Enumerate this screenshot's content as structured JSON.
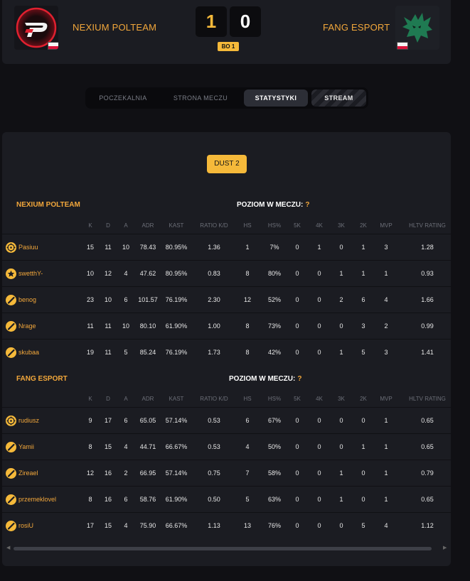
{
  "header": {
    "home": {
      "name": "NEXIUM POLTEAM",
      "score": "1"
    },
    "away": {
      "name": "FANG ESPORT",
      "score": "0"
    },
    "format": "BO 1"
  },
  "tabs": [
    {
      "label": "POCZEKALNIA",
      "active": false
    },
    {
      "label": "STRONA MECZU",
      "active": false
    },
    {
      "label": "STATYSTYKI",
      "active": true
    },
    {
      "label": "STREAM",
      "active": false
    }
  ],
  "map": "DUST 2",
  "columns": [
    "K",
    "D",
    "A",
    "ADR",
    "KAST",
    "RATIO K/D",
    "HS",
    "HS%",
    "5K",
    "4K",
    "3K",
    "2K",
    "MVP",
    "HLTV RATING"
  ],
  "teams": [
    {
      "name": "NEXIUM POLTEAM",
      "level_label": "POZIOM W MECZU:",
      "level_value": "?",
      "players": [
        {
          "icon": "crosshair-icon",
          "name": "Pasiuu",
          "stats": [
            "15",
            "11",
            "10",
            "78.43",
            "80.95%",
            "1.36",
            "1",
            "7%",
            "0",
            "1",
            "0",
            "1",
            "3",
            "1.28"
          ]
        },
        {
          "icon": "star-icon",
          "name": "swetthY-",
          "stats": [
            "10",
            "12",
            "4",
            "47.62",
            "80.95%",
            "0.83",
            "8",
            "80%",
            "0",
            "0",
            "1",
            "1",
            "1",
            "0.93"
          ]
        },
        {
          "icon": "slash-icon",
          "name": "benog",
          "stats": [
            "23",
            "10",
            "6",
            "101.57",
            "76.19%",
            "2.30",
            "12",
            "52%",
            "0",
            "0",
            "2",
            "6",
            "4",
            "1.66"
          ]
        },
        {
          "icon": "slash-icon",
          "name": "Nrage",
          "stats": [
            "11",
            "11",
            "10",
            "80.10",
            "61.90%",
            "1.00",
            "8",
            "73%",
            "0",
            "0",
            "0",
            "3",
            "2",
            "0.99"
          ]
        },
        {
          "icon": "slash-icon",
          "name": "skubaa",
          "stats": [
            "19",
            "11",
            "5",
            "85.24",
            "76.19%",
            "1.73",
            "8",
            "42%",
            "0",
            "0",
            "1",
            "5",
            "3",
            "1.41"
          ]
        }
      ]
    },
    {
      "name": "FANG ESPORT",
      "level_label": "POZIOM W MECZU:",
      "level_value": "?",
      "players": [
        {
          "icon": "crosshair-icon",
          "name": "rudiusz",
          "stats": [
            "9",
            "17",
            "6",
            "65.05",
            "57.14%",
            "0.53",
            "6",
            "67%",
            "0",
            "0",
            "0",
            "0",
            "1",
            "0.65"
          ]
        },
        {
          "icon": "slash-icon",
          "name": "Yamii",
          "stats": [
            "8",
            "15",
            "4",
            "44.71",
            "66.67%",
            "0.53",
            "4",
            "50%",
            "0",
            "0",
            "0",
            "1",
            "1",
            "0.65"
          ]
        },
        {
          "icon": "slash-icon",
          "name": "Zireael",
          "stats": [
            "12",
            "16",
            "2",
            "66.95",
            "57.14%",
            "0.75",
            "7",
            "58%",
            "0",
            "0",
            "1",
            "0",
            "1",
            "0.79"
          ]
        },
        {
          "icon": "slash-icon",
          "name": "przemeklovel",
          "stats": [
            "8",
            "16",
            "6",
            "58.76",
            "61.90%",
            "0.50",
            "5",
            "63%",
            "0",
            "0",
            "1",
            "0",
            "1",
            "0.65"
          ]
        },
        {
          "icon": "slash-icon",
          "name": "rosiU",
          "stats": [
            "17",
            "15",
            "4",
            "75.90",
            "66.67%",
            "1.13",
            "13",
            "76%",
            "0",
            "0",
            "0",
            "5",
            "4",
            "1.12"
          ]
        }
      ]
    }
  ],
  "colors": {
    "accent": "#f5b93a",
    "team_text": "#f2a73b",
    "panel": "#1b1c22",
    "background": "#101014"
  }
}
